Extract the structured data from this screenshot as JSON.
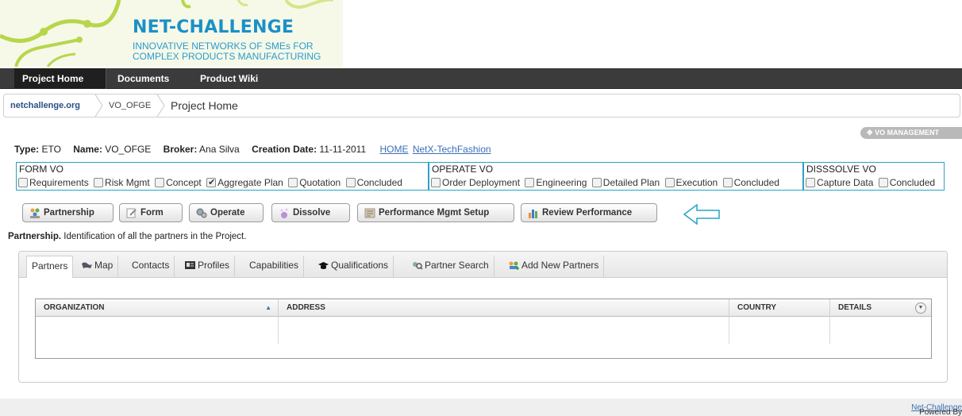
{
  "header": {
    "title": "NET-CHALLENGE",
    "subtitle_line1": "INNOVATIVE NETWORKS OF SMEs FOR",
    "subtitle_line2": "COMPLEX PRODUCTS MANUFACTURING"
  },
  "nav": {
    "items": [
      {
        "label": "Project Home"
      },
      {
        "label": "Documents"
      },
      {
        "label": "Product Wiki"
      }
    ]
  },
  "breadcrumb": {
    "items": [
      {
        "label": "netchallenge.org"
      },
      {
        "label": "VO_OFGE"
      },
      {
        "label": "Project Home"
      }
    ]
  },
  "vo_management": {
    "label": "VO MANAGEMENT"
  },
  "info": {
    "type_label": "Type:",
    "type_value": "ETO",
    "name_label": "Name:",
    "name_value": "VO_OFGE",
    "broker_label": "Broker:",
    "broker_value": "Ana Silva",
    "date_label": "Creation Date:",
    "date_value": "11-11-2011",
    "home_link": "HOME",
    "network_link": "NetX-TechFashion"
  },
  "phases": [
    {
      "title": "FORM VO",
      "items": [
        {
          "label": "Requirements",
          "checked": false
        },
        {
          "label": "Risk Mgmt",
          "checked": false
        },
        {
          "label": "Concept",
          "checked": false
        },
        {
          "label": "Aggregate Plan",
          "checked": true
        },
        {
          "label": "Quotation",
          "checked": false
        },
        {
          "label": "Concluded",
          "checked": false
        }
      ]
    },
    {
      "title": "OPERATE VO",
      "items": [
        {
          "label": "Order Deployment",
          "checked": false
        },
        {
          "label": "Engineering",
          "checked": false
        },
        {
          "label": "Detailed Plan",
          "checked": false
        },
        {
          "label": "Execution",
          "checked": false
        },
        {
          "label": "Concluded",
          "checked": false
        }
      ]
    },
    {
      "title": "DISSSOLVE VO",
      "items": [
        {
          "label": "Capture Data",
          "checked": false
        },
        {
          "label": "Concluded",
          "checked": false
        }
      ]
    }
  ],
  "actions": [
    {
      "label": "Partnership",
      "icon": "partnership-icon"
    },
    {
      "label": "Form",
      "icon": "form-icon"
    },
    {
      "label": "Operate",
      "icon": "operate-icon"
    },
    {
      "label": "Dissolve",
      "icon": "dissolve-icon"
    },
    {
      "label": "Performance Mgmt Setup",
      "icon": "performance-setup-icon"
    },
    {
      "label": "Review Performance",
      "icon": "review-performance-icon"
    }
  ],
  "description": {
    "bold": "Partnership.",
    "text": " Identification of all the partners in the Project."
  },
  "tabs": [
    {
      "label": "Partners",
      "active": true
    },
    {
      "label": "Map",
      "icon": "map-icon"
    },
    {
      "label": "Contacts"
    },
    {
      "label": "Profiles",
      "icon": "profile-card-icon"
    },
    {
      "label": "Capabilities"
    },
    {
      "label": "Qualifications",
      "icon": "graduation-cap-icon"
    },
    {
      "label": "Partner Search",
      "icon": "partner-search-icon"
    },
    {
      "label": "Add New Partners",
      "icon": "add-partners-icon"
    }
  ],
  "grid": {
    "columns": [
      {
        "label": "ORGANIZATION",
        "sort": "asc"
      },
      {
        "label": "ADDRESS"
      },
      {
        "label": "COUNTRY"
      },
      {
        "label": "DETAILS"
      }
    ],
    "rows": []
  },
  "footer": {
    "prefix": "Powered By ",
    "link": "Net-Challenge"
  },
  "colors": {
    "brand_blue": "#1c90c8",
    "nav_bg": "#3b3b3b",
    "phase_border": "#2aa3c4",
    "link": "#3b6fb6"
  }
}
